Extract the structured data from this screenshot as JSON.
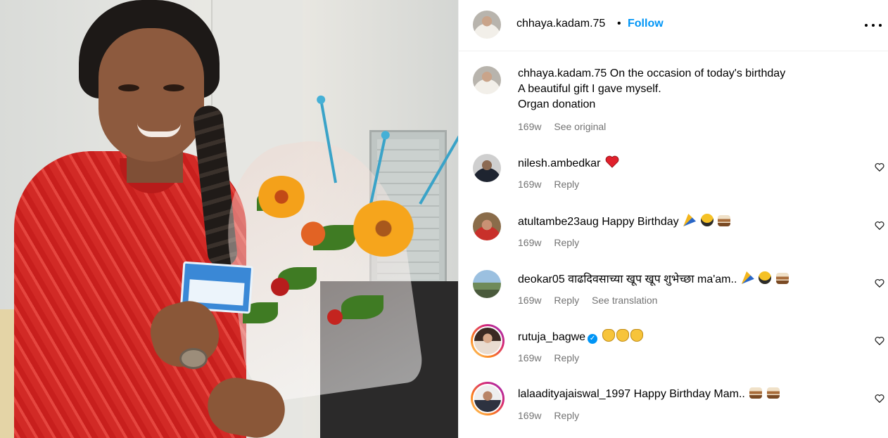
{
  "post_header": {
    "username": "chhaya.kadam.75",
    "separator": "•",
    "follow_label": "Follow"
  },
  "caption": {
    "username": "chhaya.kadam.75",
    "line1": "On the occasion of today's birthday",
    "line2": "A beautiful gift I gave myself.",
    "line3": "Organ donation",
    "time": "169w",
    "see_original": "See original"
  },
  "comments": [
    {
      "username": "nilesh.ambedkar",
      "text": "",
      "emojis": "heart",
      "time": "169w",
      "reply": "Reply"
    },
    {
      "username": "atultambe23aug",
      "text": "Happy Birthday",
      "emojis": "party-hug-cake",
      "time": "169w",
      "reply": "Reply"
    },
    {
      "username": "deokar05",
      "text": "वाढदिवसाच्या खूप खूप शुभेच्छा ma'am..",
      "emojis": "party-hug-cake",
      "time": "169w",
      "reply": "Reply",
      "translate": "See translation"
    },
    {
      "username": "rutuja_bagwe",
      "text": "",
      "emojis": "clap-clap-clap",
      "verified": true,
      "time": "169w",
      "reply": "Reply"
    },
    {
      "username": "lalaadityajaiswal_1997",
      "text": "Happy Birthday Mam..",
      "emojis": "cake-cake",
      "time": "169w",
      "reply": "Reply"
    }
  ],
  "colors": {
    "link": "#0095f6",
    "secondary_text": "#737373",
    "heart": "#ed4956"
  }
}
